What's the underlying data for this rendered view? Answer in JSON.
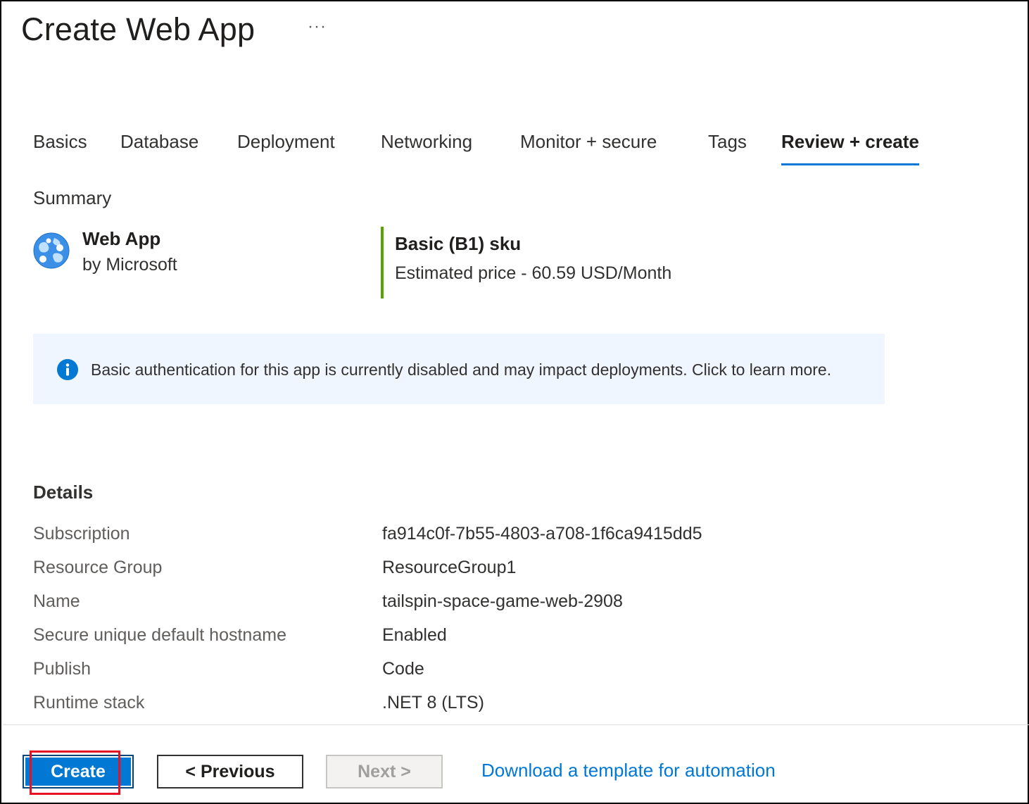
{
  "header": {
    "title": "Create Web App",
    "more_label": "···"
  },
  "tabs": [
    {
      "label": "Basics",
      "active": false
    },
    {
      "label": "Database",
      "active": false
    },
    {
      "label": "Deployment",
      "active": false
    },
    {
      "label": "Networking",
      "active": false
    },
    {
      "label": "Monitor + secure",
      "active": false
    },
    {
      "label": "Tags",
      "active": false
    },
    {
      "label": "Review + create",
      "active": true
    }
  ],
  "summary": {
    "label": "Summary",
    "product_name": "Web App",
    "product_vendor": "by Microsoft",
    "product_icon": "web-app-globe-icon",
    "sku_name": "Basic (B1) sku",
    "sku_price": "Estimated price - 60.59 USD/Month"
  },
  "info_banner": {
    "icon": "info-icon",
    "text": "Basic authentication for this app is currently disabled and may impact deployments. Click to learn more."
  },
  "details": {
    "heading": "Details",
    "rows": [
      {
        "key": "Subscription",
        "value": "fa914c0f-7b55-4803-a708-1f6ca9415dd5"
      },
      {
        "key": "Resource Group",
        "value": "ResourceGroup1"
      },
      {
        "key": "Name",
        "value": "tailspin-space-game-web-2908"
      },
      {
        "key": "Secure unique default hostname",
        "value": "Enabled"
      },
      {
        "key": "Publish",
        "value": "Code"
      },
      {
        "key": "Runtime stack",
        "value": ".NET 8 (LTS)"
      }
    ]
  },
  "footer": {
    "create_label": "Create",
    "previous_label": "< Previous",
    "next_label": "Next >",
    "next_disabled": true,
    "template_link": "Download a template for automation"
  },
  "colors": {
    "accent": "#0078d4",
    "sku_bar": "#57a300",
    "highlight": "#e81123",
    "banner_bg": "#f0f6ff"
  }
}
